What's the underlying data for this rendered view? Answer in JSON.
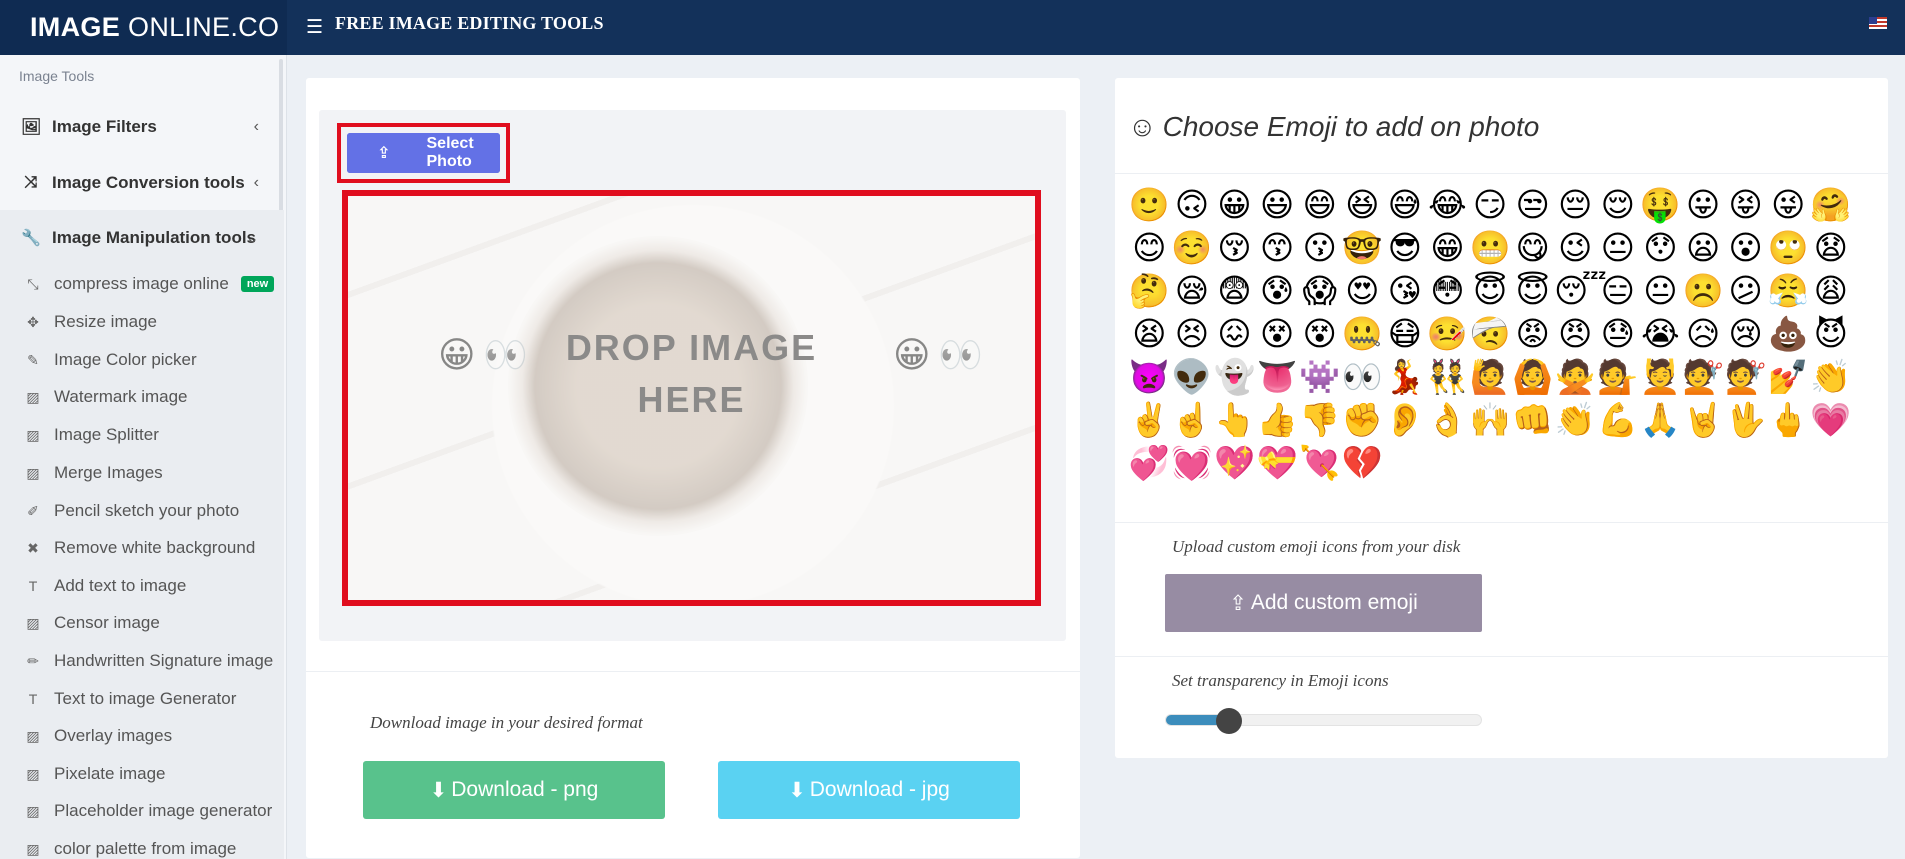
{
  "header": {
    "logo_bold": "IMAGE",
    "logo_rest": "ONLINE.CO",
    "title": "FREE IMAGE EDITING TOOLS"
  },
  "sidebar": {
    "header": "Image Tools",
    "sections": [
      {
        "label": "Image Filters",
        "icon": "image-icon"
      },
      {
        "label": "Image Conversion tools",
        "icon": "shuffle-icon"
      },
      {
        "label": "Image Manipulation tools",
        "icon": "wrench-icon"
      }
    ],
    "items": [
      {
        "label": "compress image online",
        "icon": "compress-icon",
        "badge": "new"
      },
      {
        "label": "Resize image",
        "icon": "arrows-icon"
      },
      {
        "label": "Image Color picker",
        "icon": "eyedropper-icon"
      },
      {
        "label": "Watermark image",
        "icon": "image-icon"
      },
      {
        "label": "Image Splitter",
        "icon": "image-icon"
      },
      {
        "label": "Merge Images",
        "icon": "image-icon"
      },
      {
        "label": "Pencil sketch your photo",
        "icon": "edit-icon"
      },
      {
        "label": "Remove white background",
        "icon": "close-icon"
      },
      {
        "label": "Add text to image",
        "icon": "text-icon"
      },
      {
        "label": "Censor image",
        "icon": "image-icon"
      },
      {
        "label": "Handwritten Signature image",
        "icon": "pencil-icon"
      },
      {
        "label": "Text to image Generator",
        "icon": "text-icon"
      },
      {
        "label": "Overlay images",
        "icon": "image-icon"
      },
      {
        "label": "Pixelate image",
        "icon": "image-icon"
      },
      {
        "label": "Placeholder image generator",
        "icon": "image-icon"
      },
      {
        "label": "color palette from image",
        "icon": "image-icon"
      }
    ]
  },
  "uploader": {
    "select_label": "Select Photo",
    "drop_line1": "DROP IMAGE",
    "drop_line2": "HERE"
  },
  "download": {
    "label": "Download image in your desired format",
    "png_label": "Download - png",
    "jpg_label": "Download - jpg"
  },
  "emoji_panel": {
    "title": "Choose Emoji to add on photo",
    "emojis": [
      "🙂",
      "🙃",
      "😀",
      "😃",
      "😄",
      "😆",
      "😅",
      "😂",
      "😏",
      "😒",
      "😔",
      "😌",
      "🤑",
      "😛",
      "😝",
      "😜",
      "🤗",
      "😊",
      "☺️",
      "😚",
      "😙",
      "😗",
      "🤓",
      "😎",
      "😁",
      "😬",
      "😋",
      "😉",
      "😐",
      "😯",
      "😦",
      "😮",
      "🙄",
      "😧",
      "🤔",
      "😪",
      "😨",
      "😰",
      "😱",
      "😍",
      "😘",
      "😳",
      "😇",
      "😇",
      "😴",
      "😑",
      "😐",
      "☹️",
      "😕",
      "😤",
      "😩",
      "😫",
      "😣",
      "😖",
      "😵",
      "😵",
      "🤐",
      "😷",
      "🤒",
      "🤕",
      "😡",
      "😠",
      "😓",
      "😭",
      "😥",
      "😢",
      "💩",
      "😈",
      "👿",
      "👽",
      "👻",
      "👅",
      "👾",
      "👀",
      "💃",
      "👯",
      "🙋",
      "🙆",
      "🙅",
      "💁",
      "💆",
      "💇",
      "💇",
      "💅",
      "👏",
      "✌️",
      "☝️",
      "👆",
      "👍",
      "👎",
      "✊",
      "👂",
      "👌",
      "🙌",
      "👊",
      "👏",
      "💪",
      "🙏",
      "🤘",
      "🖖",
      "🖕",
      "💗",
      "💞",
      "💓",
      "💖",
      "💝",
      "💘",
      "💔"
    ],
    "custom_label": "Upload custom emoji icons from your disk",
    "custom_button": "Add custom emoji",
    "transparency_label": "Set transparency in Emoji icons",
    "transparency_value": 0.2
  }
}
